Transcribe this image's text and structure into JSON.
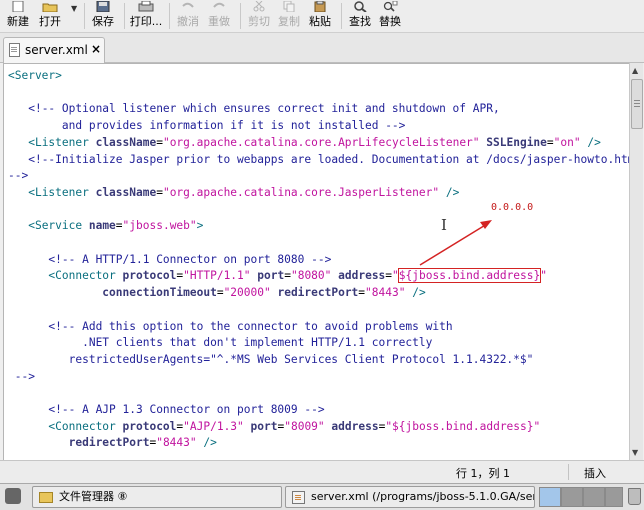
{
  "toolbar": {
    "new_label": "新建",
    "open_label": "打开",
    "save_label": "保存",
    "print_label": "打印...",
    "undo_label": "撤消",
    "redo_label": "重做",
    "cut_label": "剪切",
    "copy_label": "复制",
    "paste_label": "粘贴",
    "find_label": "查找",
    "replace_label": "替换"
  },
  "tab": {
    "title": "server.xml",
    "close": "×"
  },
  "code": {
    "l1_tag": "<Server>",
    "l3": "<!-- Optional listener which ensures correct init and shutdown of APR,",
    "l4": "     and provides information if it is not installed -->",
    "l5_open": "<Listener ",
    "l5_attr1": "className",
    "l5_val1": "\"org.apache.catalina.core.AprLifecycleListener\"",
    "l5_attr2": "SSLEngine",
    "l5_val2": "\"on\"",
    "l5_close": "/>",
    "l6": "<!--Initialize Jasper prior to webapps are loaded. Documentation at /docs/jasper-howto.html",
    "l7": "-->",
    "l8_open": "<Listener ",
    "l8_attr": "className",
    "l8_val": "\"org.apache.catalina.core.JasperListener\"",
    "l8_close": "/>",
    "l10_open": "<Service ",
    "l10_attr": "name",
    "l10_val": "\"jboss.web\"",
    "l10_close": ">",
    "l12": "<!-- A HTTP/1.1 Connector on port 8080 -->",
    "l13_open": "<Connector ",
    "l13_attr1": "protocol",
    "l13_val1": "\"HTTP/1.1\"",
    "l13_attr2": "port",
    "l13_val2": "\"8080\"",
    "l13_attr3": "address",
    "l13_val3_q": "\"",
    "l13_val3_hl": "${jboss.bind.address}",
    "l13_val3_end": "\"",
    "l14_attr1": "connectionTimeout",
    "l14_val1": "\"20000\"",
    "l14_attr2": "redirectPort",
    "l14_val2": "\"8443\"",
    "l14_close": "/>",
    "l16": "<!-- Add this option to the connector to avoid problems with",
    "l17": "     .NET clients that don't implement HTTP/1.1 correctly",
    "l18": "   restrictedUserAgents=\"^.*MS Web Services Client Protocol 1.1.4322.*$\"",
    "l19": "-->",
    "l21": "<!-- A AJP 1.3 Connector on port 8009 -->",
    "l22_open": "<Connector ",
    "l22_attr1": "protocol",
    "l22_val1": "\"AJP/1.3\"",
    "l22_attr2": "port",
    "l22_val2": "\"8009\"",
    "l22_attr3": "address",
    "l22_val3": "\"${jboss.bind.address}\"",
    "l23_attr": "redirectPort",
    "l23_val": "\"8443\"",
    "l23_close": "/>"
  },
  "annotation": {
    "label": "0.0.0.0",
    "color": "#c41a1a"
  },
  "status": {
    "position": "行 1，列 1",
    "mode": "插入"
  },
  "taskbar": {
    "file_manager": "文件管理器 ⑧",
    "editor_window": "server.xml (/programs/jboss-5.1.0.GA/ser···"
  },
  "colors": {
    "tag": "#0a6f7f",
    "attribute": "#3a3a78",
    "value": "#c0139e",
    "comment": "#222299",
    "highlight": "#d42323"
  }
}
